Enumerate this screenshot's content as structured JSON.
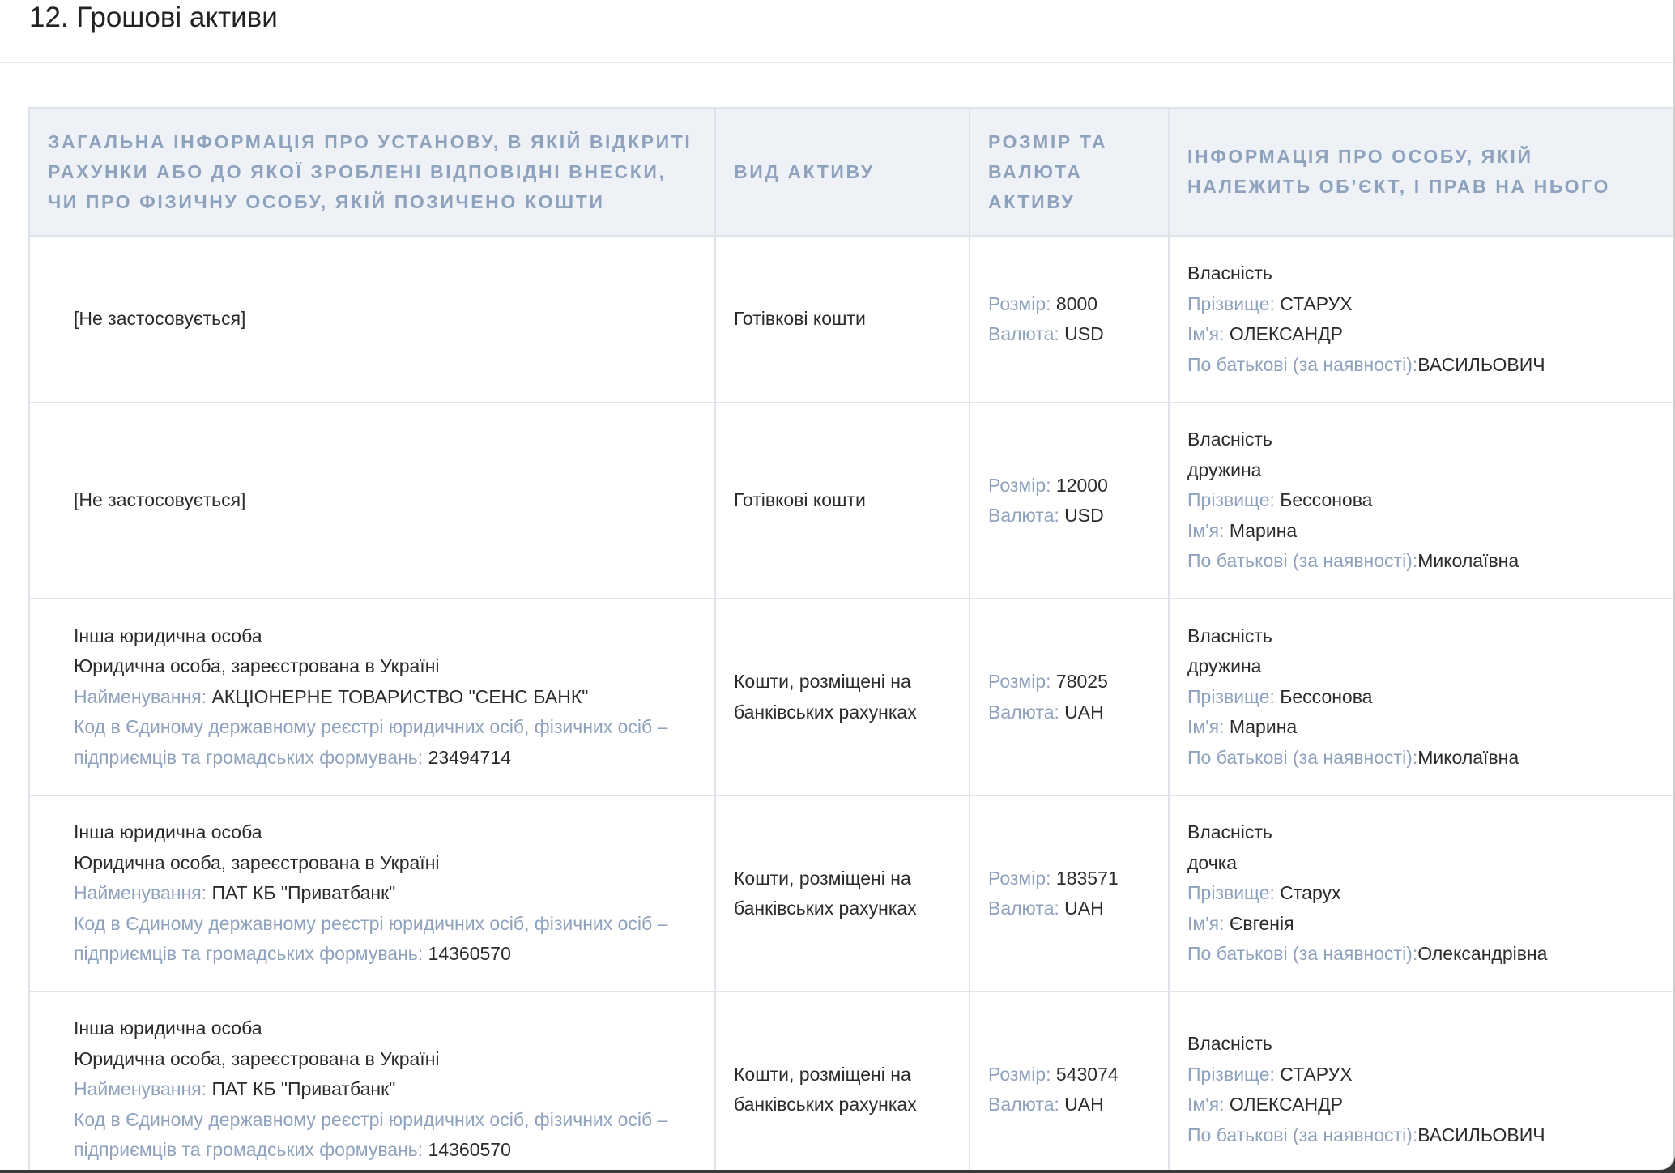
{
  "section": {
    "title": "12. Грошові активи"
  },
  "table": {
    "headers": {
      "institution": "Загальна інформація про установу, в якій відкриті рахунки або до якої зроблені відповідні внески, чи про фізичну особу, якій позичено кошти",
      "asset_type": "Вид активу",
      "amount_currency": "Розмір та валюта активу",
      "owner": "Інформація про особу, якій належить об’єкт, і прав на нього"
    },
    "labels": {
      "amount": "Розмір:",
      "currency": "Валюта:",
      "surname": "Прізвище:",
      "name": "Ім'я:",
      "patronymic": "По батькові (за наявності):",
      "entity_name": "Найменування:",
      "edrpou": "Код в Єдиному державному реєстрі юридичних осіб, фізичних осіб – підприємців та громадських формувань:"
    },
    "rows": [
      {
        "institution": {
          "not_applicable": "[Не застосовується]"
        },
        "asset_type": "Готівкові кошти",
        "amount": "8000",
        "currency": "USD",
        "owner": {
          "right": "Власність",
          "surname": "СТАРУХ",
          "name": "ОЛЕКСАНДР",
          "patronymic": "ВАСИЛЬОВИЧ"
        }
      },
      {
        "institution": {
          "not_applicable": "[Не застосовується]"
        },
        "asset_type": "Готівкові кошти",
        "amount": "12000",
        "currency": "USD",
        "owner": {
          "right": "Власність",
          "relation": "дружина",
          "surname": "Бессонова",
          "name": "Марина",
          "patronymic": "Миколаївна"
        }
      },
      {
        "institution": {
          "type": "Інша юридична особа",
          "registration": "Юридична особа, зареєстрована в Україні",
          "entity_name": "АКЦІОНЕРНЕ ТОВАРИСТВО \"СЕНС БАНК\"",
          "code": "23494714"
        },
        "asset_type": "Кошти, розміщені на банківських рахунках",
        "amount": "78025",
        "currency": "UAH",
        "owner": {
          "right": "Власність",
          "relation": "дружина",
          "surname": "Бессонова",
          "name": "Марина",
          "patronymic": "Миколаївна"
        }
      },
      {
        "institution": {
          "type": "Інша юридична особа",
          "registration": "Юридична особа, зареєстрована в Україні",
          "entity_name": "ПАТ КБ \"Приватбанк\"",
          "code": "14360570"
        },
        "asset_type": "Кошти, розміщені на банківських рахунках",
        "amount": "183571",
        "currency": "UAH",
        "owner": {
          "right": "Власність",
          "relation": "дочка",
          "surname": "Старух",
          "name": "Євгенія",
          "patronymic": "Олександрівна"
        }
      },
      {
        "institution": {
          "type": "Інша юридична особа",
          "registration": "Юридична особа, зареєстрована в Україні",
          "entity_name": "ПАТ КБ \"Приватбанк\"",
          "code": "14360570"
        },
        "asset_type": "Кошти, розміщені на банківських рахунках",
        "amount": "543074",
        "currency": "UAH",
        "owner": {
          "right": "Власність",
          "surname": "СТАРУХ",
          "name": "ОЛЕКСАНДР",
          "patronymic": "ВАСИЛЬОВИЧ"
        }
      }
    ]
  },
  "colors": {
    "label": "#8ea2bd",
    "header_bg": "#eef2f7",
    "border": "#dfe4ea",
    "text": "#2b2b2b"
  }
}
